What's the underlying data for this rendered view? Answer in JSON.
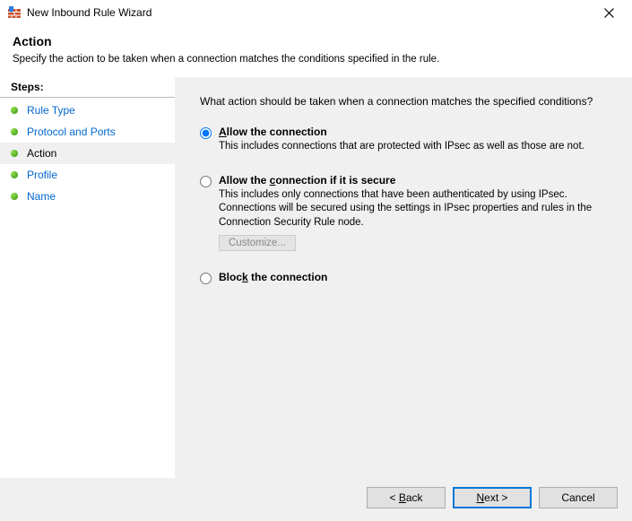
{
  "titlebar": {
    "title": "New Inbound Rule Wizard"
  },
  "header": {
    "title": "Action",
    "subtitle": "Specify the action to be taken when a connection matches the conditions specified in the rule."
  },
  "sidebar": {
    "heading": "Steps:",
    "items": [
      {
        "label": "Rule Type"
      },
      {
        "label": "Protocol and Ports"
      },
      {
        "label": "Action"
      },
      {
        "label": "Profile"
      },
      {
        "label": "Name"
      }
    ]
  },
  "main": {
    "prompt": "What action should be taken when a connection matches the specified conditions?",
    "options": {
      "allow": {
        "title_pre": "A",
        "title_rest": "llow the connection",
        "desc": "This includes connections that are protected with IPsec as well as those are not."
      },
      "allow_secure": {
        "title_pre": "Allow the ",
        "title_u": "c",
        "title_rest": "onnection if it is secure",
        "desc": "This includes only connections that have been authenticated by using IPsec.  Connections will be secured using the settings in IPsec properties and rules in the Connection Security Rule node.",
        "customize": "Customize..."
      },
      "block": {
        "title_pre": "Bloc",
        "title_u": "k",
        "title_rest": " the connection"
      }
    }
  },
  "footer": {
    "back_pre": "< ",
    "back_u": "B",
    "back_rest": "ack",
    "next_u": "N",
    "next_rest": "ext >",
    "cancel": "Cancel"
  }
}
